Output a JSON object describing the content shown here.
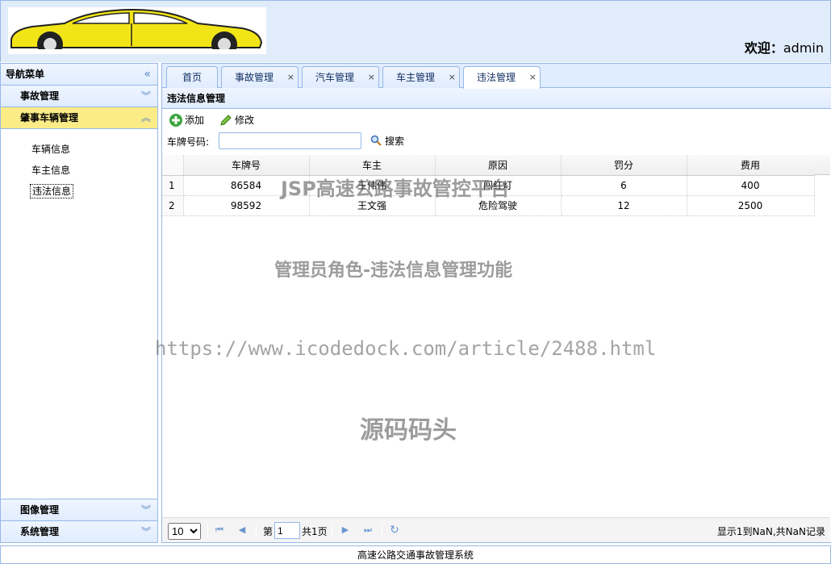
{
  "header": {
    "welcome_label": "欢迎：",
    "username": "admin"
  },
  "sidebar": {
    "title": "导航菜单",
    "groups": [
      {
        "label": "事故管理",
        "expanded": false
      },
      {
        "label": "肇事车辆管理",
        "expanded": true
      },
      {
        "label": "图像管理",
        "expanded": false
      },
      {
        "label": "系统管理",
        "expanded": false
      }
    ],
    "items": [
      "车辆信息",
      "车主信息",
      "违法信息"
    ]
  },
  "tabs": [
    "首页",
    "事故管理",
    "汽车管理",
    "车主管理",
    "违法管理"
  ],
  "panel": {
    "title": "违法信息管理"
  },
  "toolbar": {
    "add": "添加",
    "edit": "修改"
  },
  "search": {
    "label": "车牌号码:",
    "value": "",
    "button": "搜索"
  },
  "table": {
    "columns": [
      "车牌号",
      "车主",
      "原因",
      "罚分",
      "费用"
    ],
    "rows": [
      {
        "n": "1",
        "plate": "86584",
        "owner": "王伟伟",
        "reason": "闯红灯",
        "points": "6",
        "fee": "400"
      },
      {
        "n": "2",
        "plate": "98592",
        "owner": "王文强",
        "reason": "危险驾驶",
        "points": "12",
        "fee": "2500"
      }
    ]
  },
  "pager": {
    "page_size": "10",
    "page_prefix": "第",
    "page": "1",
    "page_suffix": "共1页",
    "info": "显示1到NaN,共NaN记录"
  },
  "watermarks": {
    "w1": "JSP高速公路事故管控平台",
    "w2": "管理员角色-违法信息管理功能",
    "w3": "https://www.icodedock.com/article/2488.html",
    "w4": "源码码头"
  },
  "footer": {
    "text": "高速公路交通事故管理系统"
  },
  "colors": {
    "accent": "#95b8e7",
    "header_bg": "#e1ecfb",
    "active_group": "#fbec88",
    "car": "#f5e91a"
  }
}
